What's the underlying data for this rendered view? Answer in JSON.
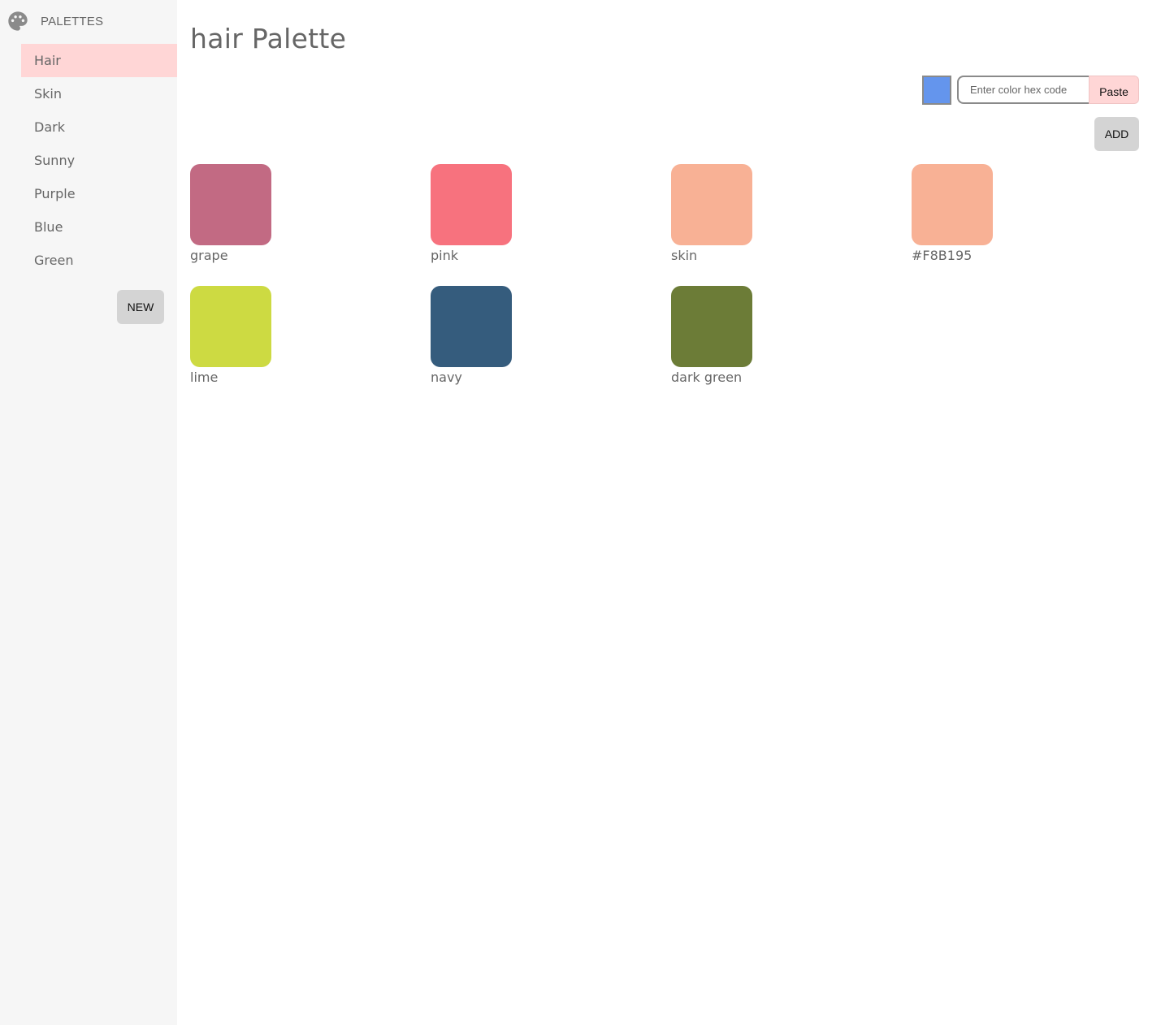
{
  "sidebar": {
    "title": "PALETTES",
    "items": [
      {
        "label": "Hair",
        "active": true
      },
      {
        "label": "Skin"
      },
      {
        "label": "Dark"
      },
      {
        "label": "Sunny"
      },
      {
        "label": "Purple"
      },
      {
        "label": "Blue"
      },
      {
        "label": "Green"
      }
    ],
    "new_label": "NEW"
  },
  "main": {
    "title": "hair Palette",
    "picker": {
      "current_color": "#6495ED",
      "placeholder": "Enter color hex code",
      "paste_label": "Paste",
      "add_label": "ADD"
    },
    "colors": [
      {
        "name": "grape",
        "hex": "#C26A83"
      },
      {
        "name": "pink",
        "hex": "#F7727E"
      },
      {
        "name": "skin",
        "hex": "#F8B195"
      },
      {
        "name": "#F8B195",
        "hex": "#F8B195"
      },
      {
        "name": "lime",
        "hex": "#CDDA42"
      },
      {
        "name": "navy",
        "hex": "#355C7D"
      },
      {
        "name": "dark green",
        "hex": "#6C7C37"
      }
    ]
  },
  "theme": {
    "sidebar_bg": "#F6F6F6",
    "active_bg": "#FFD6D6",
    "button_bg": "#D4D4D4",
    "text": "#666666"
  }
}
